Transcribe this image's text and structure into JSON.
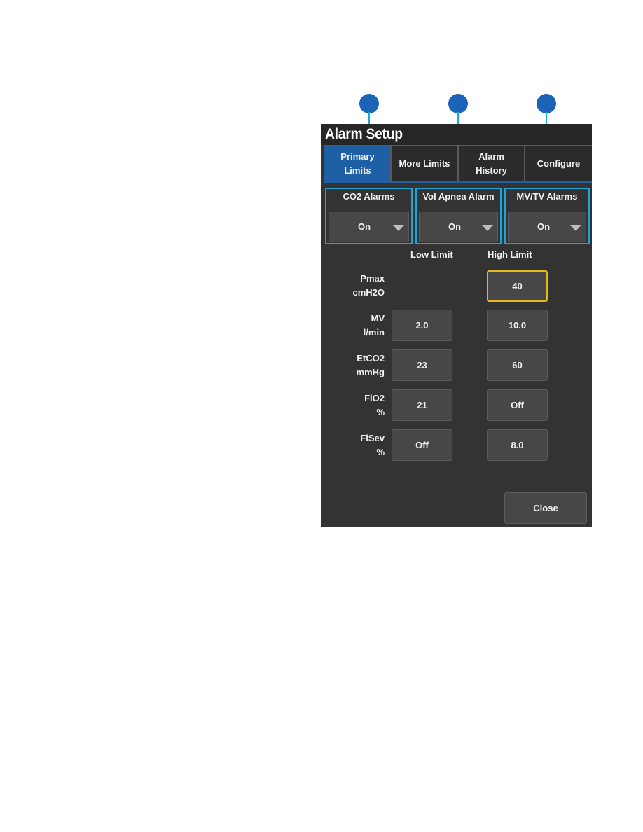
{
  "callouts": [
    {
      "id": 1,
      "target": "CO2 Alarms"
    },
    {
      "id": 2,
      "target": "Vol Apnea Alarm"
    },
    {
      "id": 3,
      "target": "MV/TV Alarms"
    }
  ],
  "window": {
    "title": "Alarm Setup"
  },
  "tabs": [
    {
      "label": "Primary\nLimits",
      "active": true
    },
    {
      "label": "More Limits",
      "active": false
    },
    {
      "label": "Alarm\nHistory",
      "active": false
    },
    {
      "label": "Configure",
      "active": false
    }
  ],
  "alarm_groups": [
    {
      "label": "CO2 Alarms",
      "value": "On"
    },
    {
      "label": "Vol Apnea Alarm",
      "value": "On"
    },
    {
      "label": "MV/TV Alarms",
      "value": "On"
    }
  ],
  "columns": {
    "low": "Low Limit",
    "high": "High Limit"
  },
  "limits": [
    {
      "label": "Pmax\ncmH2O",
      "low": null,
      "high": "40",
      "high_selected": true
    },
    {
      "label": "MV\nl/min",
      "low": "2.0",
      "high": "10.0"
    },
    {
      "label": "EtCO2\nmmHg",
      "low": "23",
      "high": "60"
    },
    {
      "label": "FiO2\n%",
      "low": "21",
      "high": "Off"
    },
    {
      "label": "FiSev\n%",
      "low": "Off",
      "high": "8.0"
    }
  ],
  "buttons": {
    "close": "Close"
  },
  "colors": {
    "accent": "#1f5fa5",
    "callout": "#1c64b8",
    "callout_line": "#1aa6d8",
    "selected_border": "#e6b820"
  }
}
